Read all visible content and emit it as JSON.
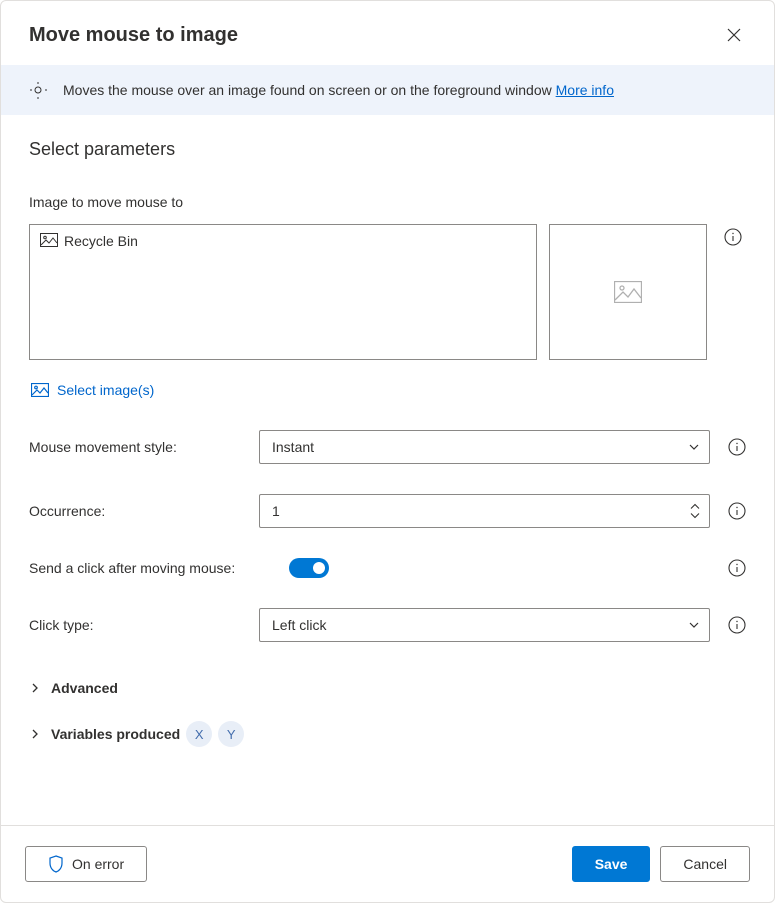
{
  "header": {
    "title": "Move mouse to image"
  },
  "infobar": {
    "text": "Moves the mouse over an image found on screen or on the foreground window ",
    "link_text": "More info"
  },
  "section_title": "Select parameters",
  "image_field": {
    "label": "Image to move mouse to",
    "selected_item": "Recycle Bin",
    "select_button": "Select image(s)"
  },
  "movement_style": {
    "label": "Mouse movement style:",
    "value": "Instant"
  },
  "occurrence": {
    "label": "Occurrence:",
    "value": "1"
  },
  "send_click": {
    "label": "Send a click after moving mouse:",
    "enabled": true
  },
  "click_type": {
    "label": "Click type:",
    "value": "Left click"
  },
  "advanced": {
    "label": "Advanced"
  },
  "variables": {
    "label": "Variables produced",
    "vars": [
      "X",
      "Y"
    ]
  },
  "footer": {
    "on_error": "On error",
    "save": "Save",
    "cancel": "Cancel"
  }
}
